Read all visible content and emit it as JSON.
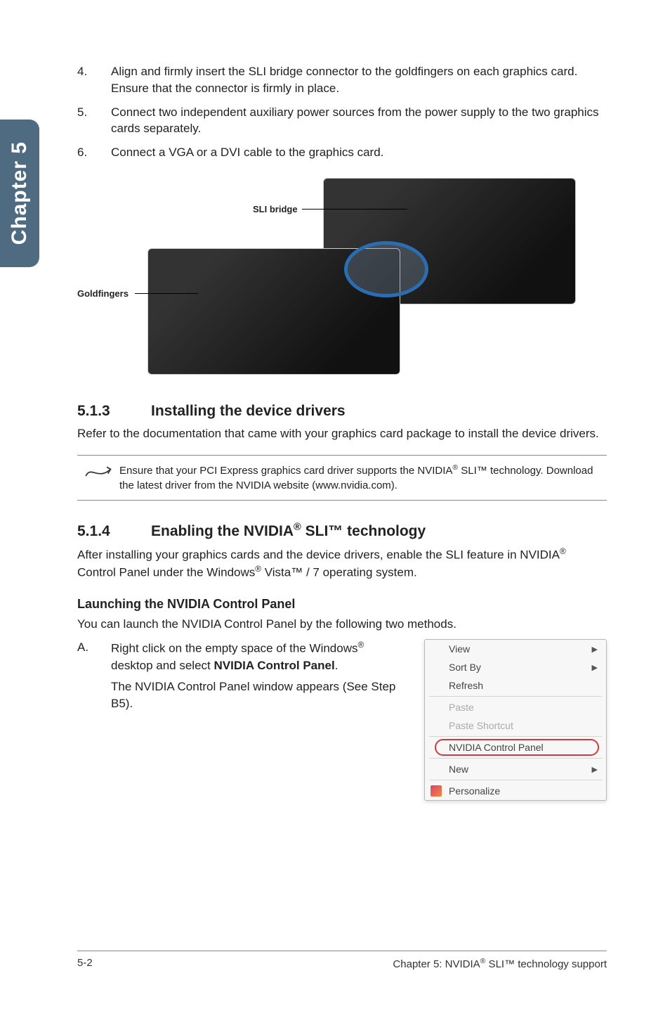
{
  "side_tab": "Chapter 5",
  "steps": [
    {
      "num": "4.",
      "text": "Align and firmly insert the SLI bridge connector to the goldfingers on each graphics card. Ensure that the connector is firmly in place."
    },
    {
      "num": "5.",
      "text": "Connect two independent auxiliary power sources from the power supply to the two graphics cards separately."
    },
    {
      "num": "6.",
      "text": "Connect a VGA or a DVI cable to the graphics card."
    }
  ],
  "figure": {
    "sli_label": "SLI bridge",
    "gold_label": "Goldfingers"
  },
  "sec513": {
    "num": "5.1.3",
    "title": "Installing the device drivers",
    "para": "Refer to the documentation that came with your graphics card package to install the device drivers."
  },
  "note1": {
    "pre": "Ensure that your PCI Express graphics card driver supports the NVIDIA",
    "sup": "®",
    "post": " SLI™ technology. Download the latest driver from the NVIDIA website (www.nvidia.com)."
  },
  "sec514": {
    "num": "5.1.4",
    "title_pre": "Enabling the NVIDIA",
    "title_sup": "®",
    "title_post": " SLI™ technology",
    "para_pre": "After installing your graphics cards and the device drivers, enable the SLI feature in NVIDIA",
    "para_sup1": "®",
    "para_mid": " Control Panel under the Windows",
    "para_sup2": "®",
    "para_post": " Vista™ / 7 operating system."
  },
  "launch": {
    "heading": "Launching the NVIDIA Control Panel",
    "intro": "You can launch the NVIDIA Control Panel by the following two methods.",
    "item": {
      "letter": "A.",
      "line1_pre": "Right click on the empty space of the Windows",
      "line1_sup": "®",
      "line1_post": " desktop and select ",
      "line1_bold": "NVIDIA Control Panel",
      "line1_end": ".",
      "line2": "The NVIDIA Control Panel window appears (See Step B5)."
    }
  },
  "contextmenu": {
    "view": "View",
    "sortby": "Sort By",
    "refresh": "Refresh",
    "paste": "Paste",
    "pasteshortcut": "Paste Shortcut",
    "nvcp": "NVIDIA Control Panel",
    "new": "New",
    "personalize": "Personalize"
  },
  "footer": {
    "left": "5-2",
    "right_pre": "Chapter 5: NVIDIA",
    "right_sup": "®",
    "right_post": " SLI™ technology support"
  }
}
